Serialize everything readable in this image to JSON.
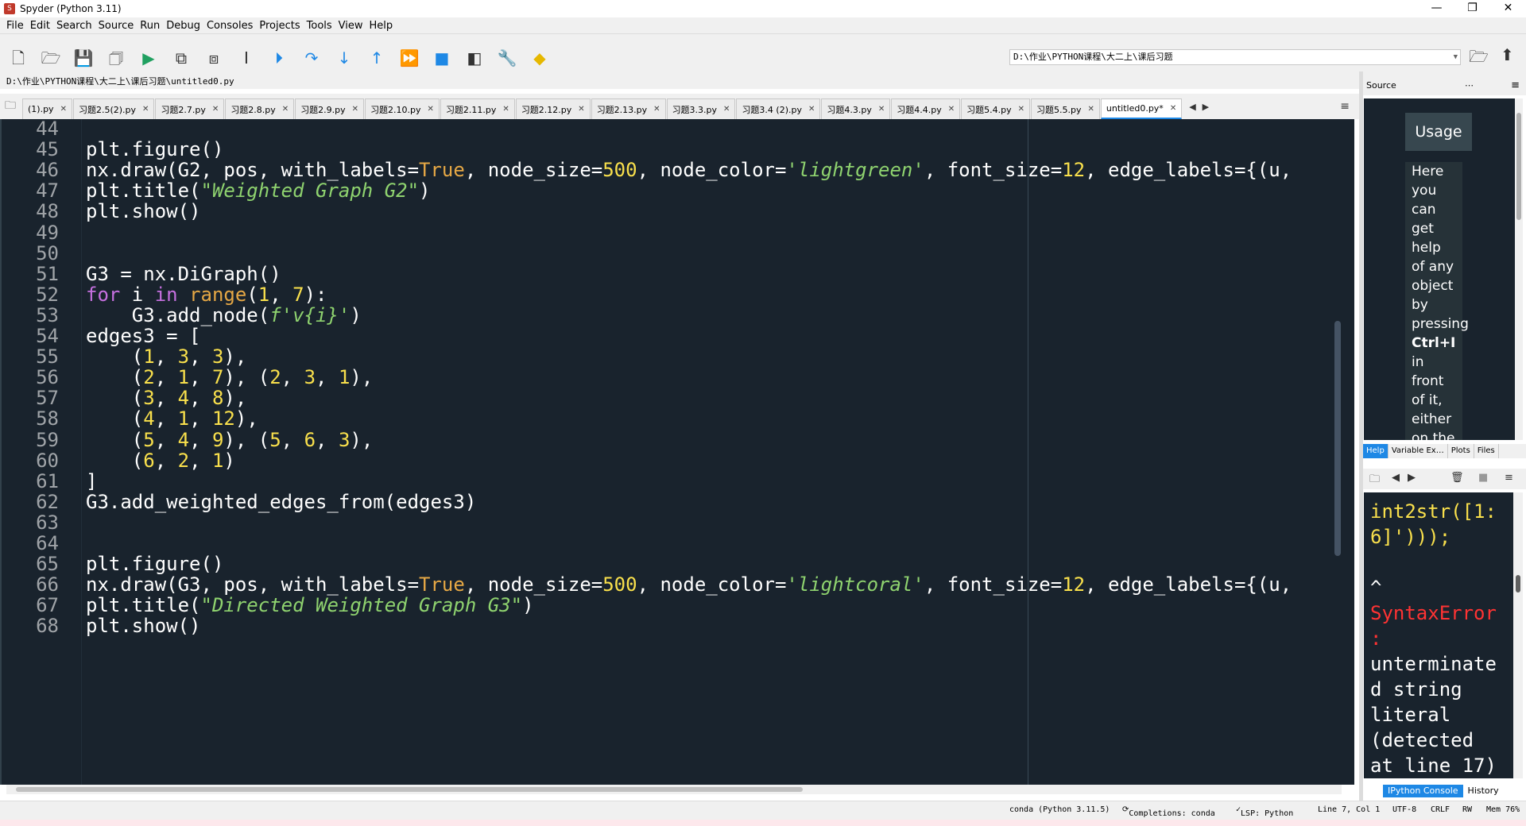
{
  "window": {
    "title": "Spyder (Python 3.11)",
    "minimize": "—",
    "maximize": "❐",
    "close": "✕"
  },
  "menu": [
    "File",
    "Edit",
    "Search",
    "Source",
    "Run",
    "Debug",
    "Consoles",
    "Projects",
    "Tools",
    "View",
    "Help"
  ],
  "toolbar": {
    "working_dir": "D:\\作业\\PYTHON课程\\大二上\\课后习题"
  },
  "editor": {
    "file_path": "D:\\作业\\PYTHON课程\\大二上\\课后习题\\untitled0.py",
    "tabs": [
      {
        "label": "(1).py"
      },
      {
        "label": "习题2.5(2).py"
      },
      {
        "label": "习题2.7.py"
      },
      {
        "label": "习题2.8.py"
      },
      {
        "label": "习题2.9.py"
      },
      {
        "label": "习题2.10.py"
      },
      {
        "label": "习题2.11.py"
      },
      {
        "label": "习题2.12.py"
      },
      {
        "label": "习题2.13.py"
      },
      {
        "label": "习题3.3.py"
      },
      {
        "label": "习题3.4 (2).py"
      },
      {
        "label": "习题4.3.py"
      },
      {
        "label": "习题4.4.py"
      },
      {
        "label": "习题5.4.py"
      },
      {
        "label": "习题5.5.py"
      },
      {
        "label": "untitled0.py*",
        "active": true
      }
    ],
    "lines": [
      {
        "n": "44",
        "html": ""
      },
      {
        "n": "45",
        "html": "plt.figure()"
      },
      {
        "n": "46",
        "html": "nx.draw(G2, pos, with_labels=<span class='const'>True</span>, node_size=<span class='num'>500</span>, node_color=<span class='str'>'lightgreen'</span>, font_size=<span class='num'>12</span>, edge_labels={(u,"
      },
      {
        "n": "47",
        "html": "plt.title(<span class='str'>\"Weighted Graph G2\"</span>)"
      },
      {
        "n": "48",
        "html": "plt.show()"
      },
      {
        "n": "49",
        "html": ""
      },
      {
        "n": "50",
        "html": ""
      },
      {
        "n": "51",
        "html": "G3 = nx.DiGraph()"
      },
      {
        "n": "52",
        "html": "<span class='kw'>for</span> i <span class='kw'>in</span> <span class='bi'>range</span>(<span class='num'>1</span>, <span class='num'>7</span>):"
      },
      {
        "n": "53",
        "html": "    G3.add_node(<span class='str'>f'v{i}'</span>)"
      },
      {
        "n": "54",
        "html": "edges3 = ["
      },
      {
        "n": "55",
        "html": "    (<span class='num'>1</span>, <span class='num'>3</span>, <span class='num'>3</span>),"
      },
      {
        "n": "56",
        "html": "    (<span class='num'>2</span>, <span class='num'>1</span>, <span class='num'>7</span>), (<span class='num'>2</span>, <span class='num'>3</span>, <span class='num'>1</span>),"
      },
      {
        "n": "57",
        "html": "    (<span class='num'>3</span>, <span class='num'>4</span>, <span class='num'>8</span>),"
      },
      {
        "n": "58",
        "html": "    (<span class='num'>4</span>, <span class='num'>1</span>, <span class='num'>12</span>),"
      },
      {
        "n": "59",
        "html": "    (<span class='num'>5</span>, <span class='num'>4</span>, <span class='num'>9</span>), (<span class='num'>5</span>, <span class='num'>6</span>, <span class='num'>3</span>),"
      },
      {
        "n": "60",
        "html": "    (<span class='num'>6</span>, <span class='num'>2</span>, <span class='num'>1</span>)"
      },
      {
        "n": "61",
        "html": "]"
      },
      {
        "n": "62",
        "html": "G3.add_weighted_edges_from(edges3)"
      },
      {
        "n": "63",
        "html": ""
      },
      {
        "n": "64",
        "html": ""
      },
      {
        "n": "65",
        "html": "plt.figure()"
      },
      {
        "n": "66",
        "html": "nx.draw(G3, pos, with_labels=<span class='const'>True</span>, node_size=<span class='num'>500</span>, node_color=<span class='str'>'lightcoral'</span>, font_size=<span class='num'>12</span>, edge_labels={(u,"
      },
      {
        "n": "67",
        "html": "plt.title(<span class='str'>\"Directed Weighted Graph G3\"</span>)"
      },
      {
        "n": "68",
        "html": "plt.show()"
      }
    ]
  },
  "help": {
    "source_label": "Source",
    "usage_title": "Usage",
    "usage_words": [
      "Here",
      "you",
      "can",
      "get",
      "help",
      "of any",
      "object",
      "by",
      "pressing",
      "Ctrl+I",
      "in",
      "front",
      "of it,",
      "either",
      "on the"
    ],
    "tabs": [
      "Help",
      "Variable Ex…",
      "Plots",
      "Files"
    ]
  },
  "console": {
    "lines": [
      {
        "cls": "c-yellow",
        "text": "int2str([1:"
      },
      {
        "cls": "c-yellow",
        "text": "6]')));"
      },
      {
        "cls": "c-white",
        "text": ""
      },
      {
        "cls": "c-white",
        "text": "^"
      },
      {
        "cls": "c-red",
        "text": "SyntaxError"
      },
      {
        "cls": "c-red",
        "text": ":"
      },
      {
        "cls": "c-white",
        "text": "unterminate"
      },
      {
        "cls": "c-white",
        "text": "d string"
      },
      {
        "cls": "c-white",
        "text": "literal"
      },
      {
        "cls": "c-white",
        "text": "(detected"
      },
      {
        "cls": "c-white",
        "text": "at line 17)"
      }
    ],
    "tabs": [
      "IPython Console",
      "History"
    ]
  },
  "status": {
    "env": "conda (Python 3.11.5)",
    "completions": "Completions: conda",
    "lsp": "LSP: Python",
    "position": "Line 7, Col 1",
    "encoding": "UTF-8",
    "eol": "CRLF",
    "mode": "RW",
    "memory": "Mem 76%"
  },
  "colors": {
    "editor_bg": "#19232d",
    "accent": "#1e88e5",
    "error": "#ff3333"
  }
}
